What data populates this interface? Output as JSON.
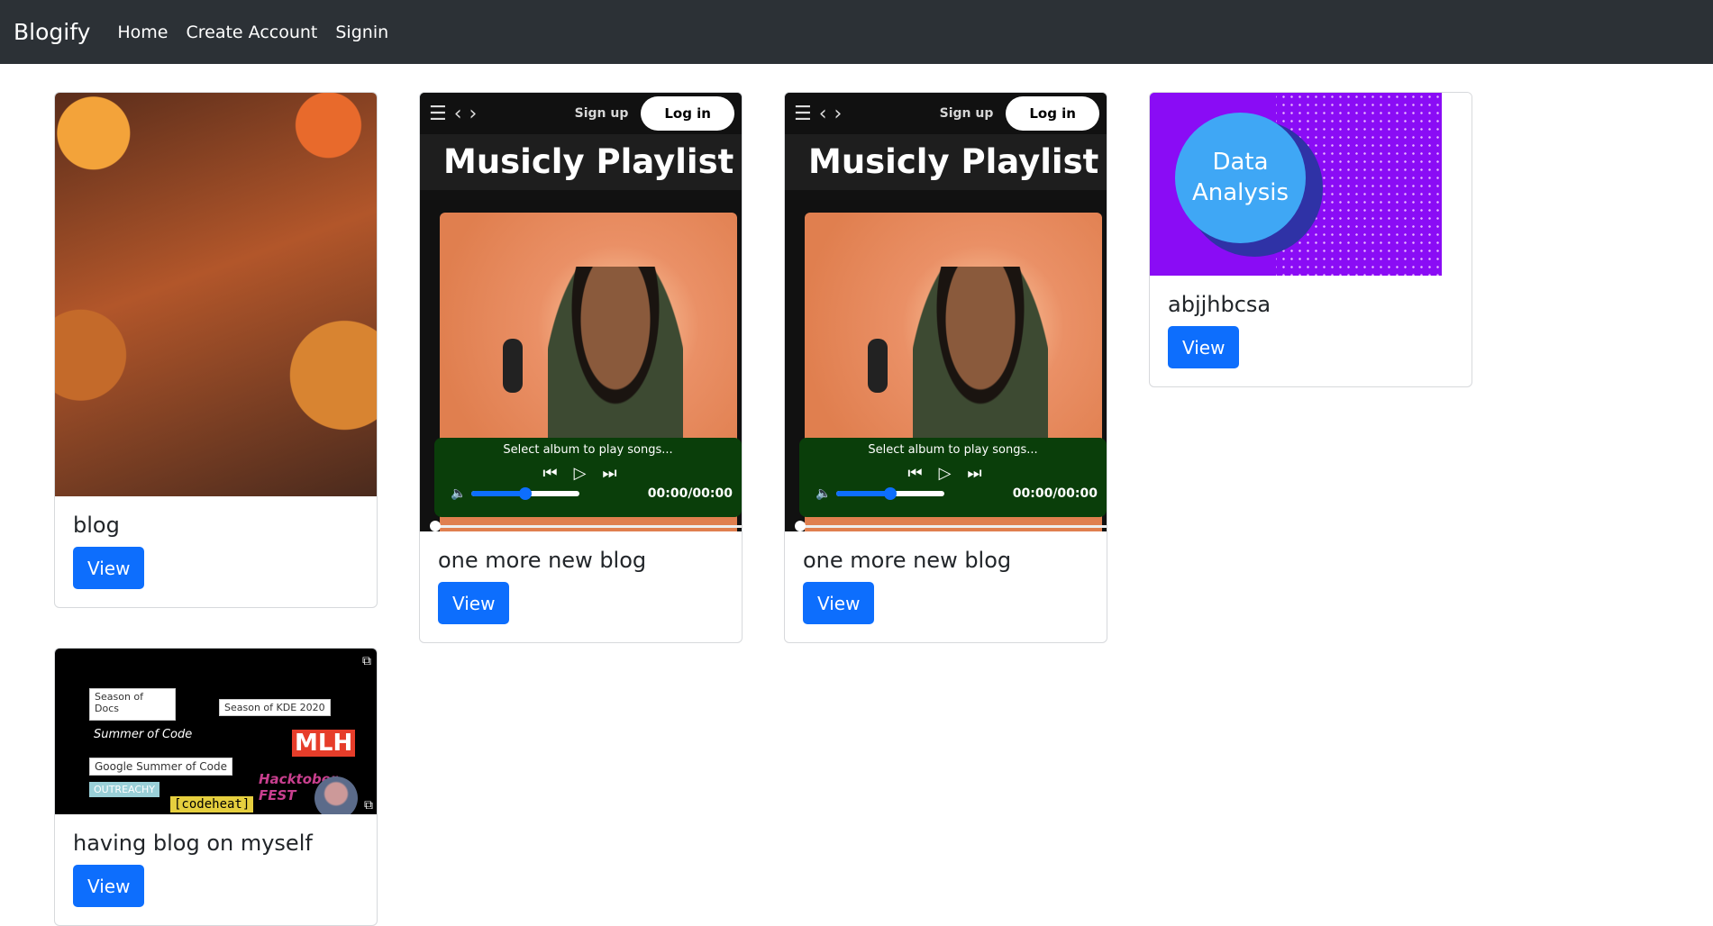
{
  "navbar": {
    "brand": "Blogify",
    "links": [
      "Home",
      "Create Account",
      "Signin"
    ]
  },
  "cards": [
    {
      "title": "blog",
      "button": "View",
      "image": "deity-figurine-image"
    },
    {
      "title": "one more new blog",
      "button": "View",
      "image": "music-player-image",
      "player": {
        "signup": "Sign up",
        "login": "Log in",
        "heading": "Musicly Playlist",
        "status": "Select album to play songs...",
        "time": "00:00/00:00",
        "volume": 0.5
      }
    },
    {
      "title": "one more new blog",
      "button": "View",
      "image": "music-player-image",
      "player": {
        "signup": "Sign up",
        "login": "Log in",
        "heading": "Musicly Playlist",
        "status": "Select album to play songs...",
        "time": "00:00/00:00",
        "volume": 0.5
      }
    },
    {
      "title": "abjjhbcsa",
      "button": "View",
      "image": "data-analysis-image",
      "graphic_text": "Data Analysis"
    },
    {
      "title": "having blog on myself",
      "button": "View",
      "image": "open-source-collage-image",
      "collage": [
        "Season of Docs",
        "Season of KDE 2020",
        "Summer of Code",
        "Google Summer of Code",
        "OUTREACHY",
        "[codeheat]",
        "MLH",
        "Hacktober FEST"
      ]
    }
  ],
  "colors": {
    "navbar": "#2c3136",
    "primary": "#0d6efd",
    "player_green": "#0a3e0a",
    "data_purple": "#8a0cf5"
  }
}
